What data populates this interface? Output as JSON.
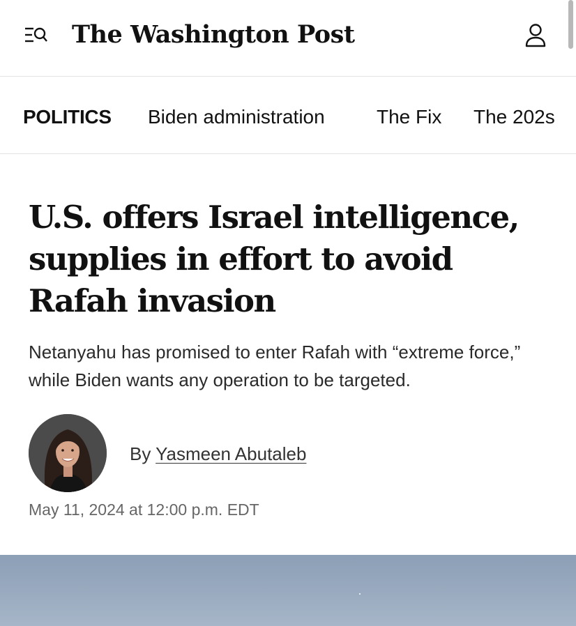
{
  "header": {
    "brand": "The Washington Post",
    "menu_icon": "menu-search-icon",
    "account_icon": "user-account-icon"
  },
  "subnav": {
    "section": "POLITICS",
    "items": [
      "Biden administration",
      "The Fix",
      "The 202s"
    ]
  },
  "article": {
    "headline": "U.S. offers Israel intelligence, supplies in effort to avoid Rafah invasion",
    "dek": "Netanyahu has promised to enter Rafah with “extreme force,” while Biden wants any operation to be targeted.",
    "byline_prefix": "By",
    "author": "Yasmeen Abutaleb",
    "timestamp": "May 11, 2024 at 12:00 p.m. EDT"
  },
  "colors": {
    "text": "#111111",
    "muted": "#666666",
    "divider": "#e3e3e3",
    "hero_sky": "#9aabc0"
  }
}
